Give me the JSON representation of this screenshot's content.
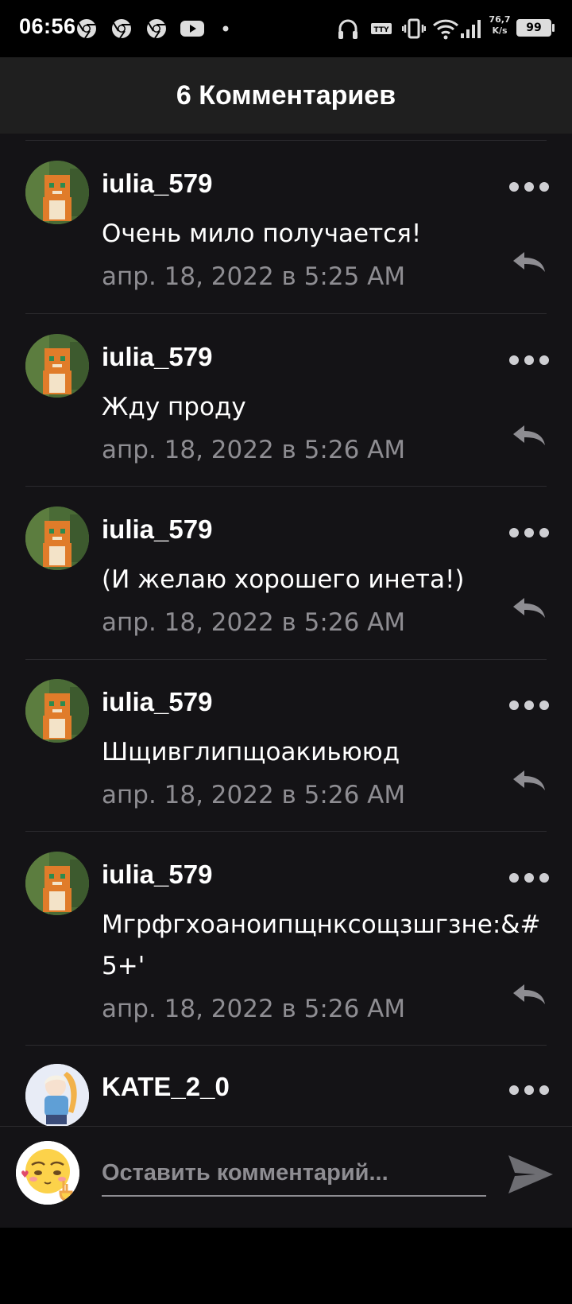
{
  "status_bar": {
    "time": "06:56",
    "net_speed_top": "76,7",
    "net_speed_bottom": "K/s",
    "battery": "99",
    "left_icons": [
      "chrome-icon",
      "chrome-icon",
      "chrome-icon",
      "youtube-icon",
      "dot-icon"
    ],
    "right_icons": [
      "headphones-icon",
      "tty-icon",
      "vibrate-icon",
      "wifi-icon",
      "signal-icon",
      "battery-icon"
    ]
  },
  "header": {
    "title": "6 Комментариев"
  },
  "comments": [
    {
      "username": "iulia_579",
      "text": "Очень мило получается!",
      "date": "апр. 18, 2022 в 5:25 AM"
    },
    {
      "username": "iulia_579",
      "text": "Жду проду",
      "date": "апр. 18, 2022 в 5:26 AM"
    },
    {
      "username": "iulia_579",
      "text": "(И желаю хорошего инета!)",
      "date": "апр. 18, 2022 в 5:26 AM"
    },
    {
      "username": "iulia_579",
      "text": "Шщивглипщоакиьююд",
      "date": "апр. 18, 2022 в 5:26 AM"
    },
    {
      "username": "iulia_579",
      "text": "Мгрфгхоаноипщнкcощзшгзне:&#5+'",
      "date": "апр. 18, 2022 в 5:26 AM"
    },
    {
      "username": "KATE_2_0",
      "text": "",
      "date": ""
    }
  ],
  "input": {
    "placeholder": "Оставить комментарий..."
  },
  "colors": {
    "background": "#141316",
    "header": "#1f1f1f",
    "muted": "#8e8d92",
    "divider": "#2c2b2f"
  }
}
